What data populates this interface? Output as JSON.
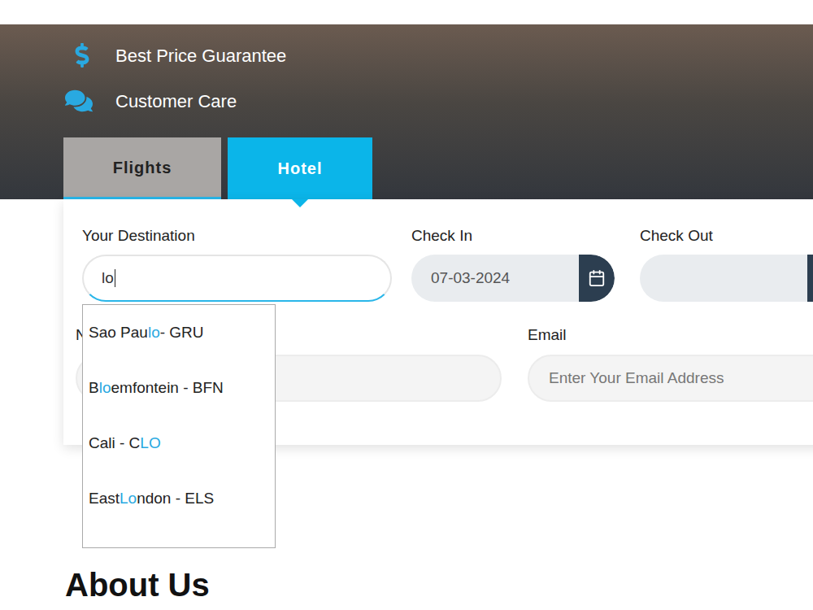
{
  "features": [
    {
      "label": "Best Price Guarantee",
      "kind": "price"
    },
    {
      "label": "Customer Care",
      "kind": "support"
    }
  ],
  "tabs": [
    {
      "label": "Flights",
      "selected": false
    },
    {
      "label": "Hotel",
      "selected": true
    }
  ],
  "form": {
    "destination": {
      "label": "Your Destination",
      "value": "lo",
      "focused": true
    },
    "check_in": {
      "label": "Check In",
      "value": "07-03-2024"
    },
    "check_out": {
      "label": "Check Out",
      "value": ""
    },
    "name": {
      "label": "N"
    },
    "email": {
      "label": "Email",
      "placeholder": "Enter Your Email Address"
    }
  },
  "autocomplete": {
    "items": [
      {
        "before": "Sao Pau",
        "match": "lo",
        "after": " - GRU"
      },
      {
        "before": "B",
        "match": "lo",
        "after": "emfontein - BFN"
      },
      {
        "before": "Cali - C",
        "match": "LO",
        "after": ""
      },
      {
        "before": "East ",
        "match": "Lo",
        "after": "ndon - ELS"
      }
    ]
  },
  "about": {
    "title": "About Us"
  }
}
